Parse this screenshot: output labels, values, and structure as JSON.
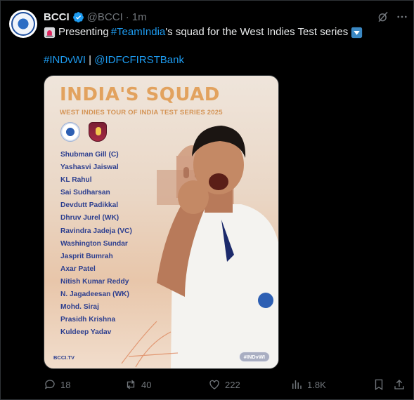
{
  "post": {
    "author_name": "BCCI",
    "handle": "@BCCI",
    "separator": "·",
    "time": "1m",
    "text_lead": "Presenting",
    "text_hashtag": "#TeamIndia",
    "text_rest": "'s squad for the West Indies Test series",
    "hashtag_line_1": "#INDvWI",
    "hashtag_line_sep": " | ",
    "hashtag_line_2": "@IDFCFIRSTBank"
  },
  "media": {
    "title": "INDIA'S SQUAD",
    "subtitle": "WEST INDIES TOUR OF INDIA TEST SERIES 2025",
    "players": [
      "Shubman Gill (C)",
      "Yashasvi Jaiswal",
      "KL Rahul",
      "Sai Sudharsan",
      "Devdutt Padikkal",
      "Dhruv Jurel (WK)",
      "Ravindra Jadeja (VC)",
      "Washington Sundar",
      "Jasprit Bumrah",
      "Axar Patel",
      "Nitish Kumar Reddy",
      "N. Jagadeesan (WK)",
      "Mohd. Siraj",
      "Prasidh Krishna",
      "Kuldeep Yadav"
    ],
    "footer_left": "BCCI.TV",
    "footer_right": "#INDvWI"
  },
  "actions": {
    "replies": "18",
    "reposts": "40",
    "likes": "222",
    "views": "1.8K"
  },
  "icons": [
    "verified-badge-icon",
    "grok-icon",
    "more-icon",
    "siren-emoji",
    "down-arrow-emoji",
    "reply-icon",
    "repost-icon",
    "like-icon",
    "views-icon",
    "bookmark-icon",
    "share-icon"
  ],
  "colors": {
    "background": "#000000",
    "text": "#e7e9ea",
    "muted": "#71767b",
    "link": "#1d9bf0",
    "title": "#e2a25e",
    "players": "#2d3f8f"
  }
}
